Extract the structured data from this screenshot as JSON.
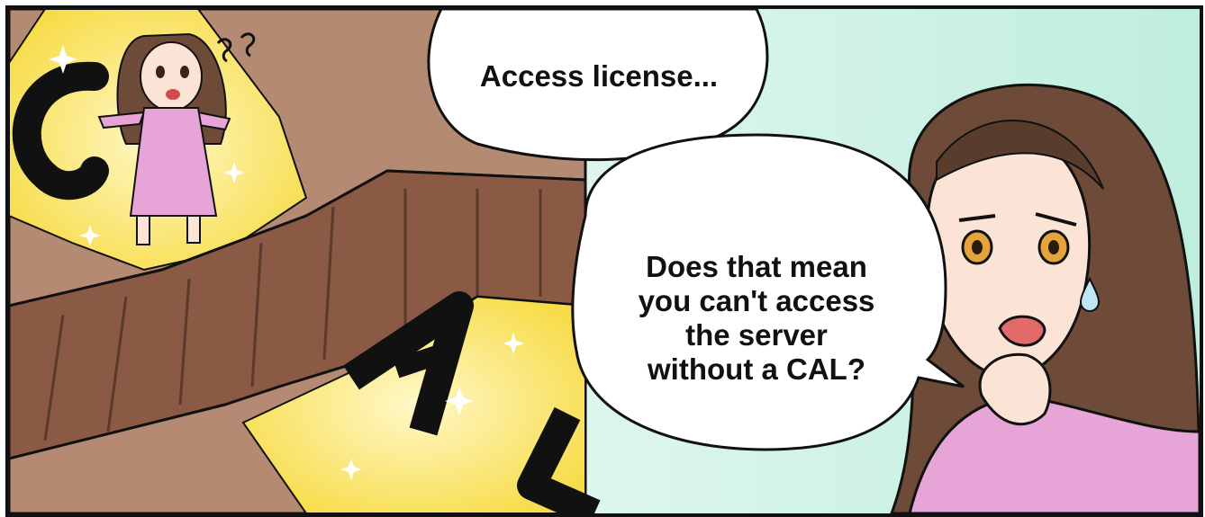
{
  "panel": {
    "speech_bubbles": [
      {
        "text": "Access license..."
      },
      {
        "lines": [
          "Does that mean",
          "you can't access",
          "the server",
          "without a CAL?"
        ]
      }
    ],
    "ground_letters": "CAL",
    "colors": {
      "cliff_brown": "#a8785f",
      "cliff_dark": "#7a4f3a",
      "glow_yellow": "#fbe46a",
      "background_mint": "#dff5ec",
      "dress_pink": "#e7a4d6",
      "hair_brown": "#6d4b38",
      "skin": "#fbe3d6",
      "outline": "#111111"
    },
    "icons": [
      "confused-squiggle-icon",
      "sweat-drop-icon",
      "sparkle-icon"
    ]
  }
}
